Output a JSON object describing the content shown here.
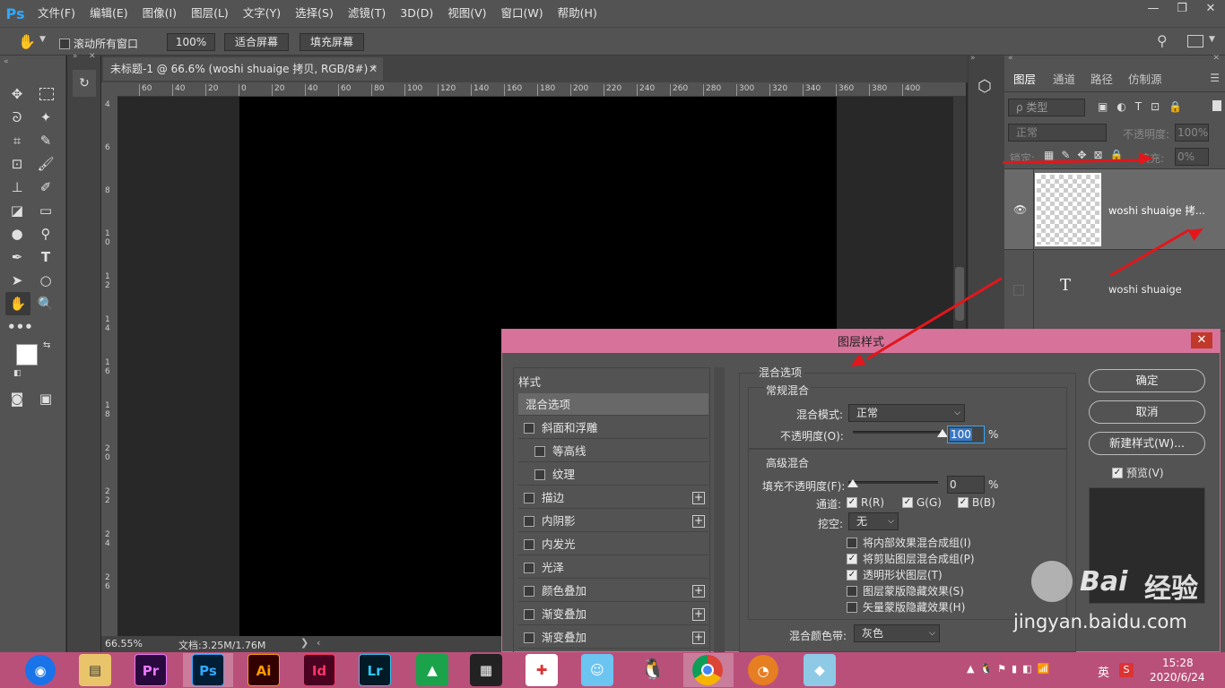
{
  "app": {
    "logo": "Ps"
  },
  "menu": [
    "文件(F)",
    "编辑(E)",
    "图像(I)",
    "图层(L)",
    "文字(Y)",
    "选择(S)",
    "滤镜(T)",
    "3D(D)",
    "视图(V)",
    "窗口(W)",
    "帮助(H)"
  ],
  "window_controls": {
    "minimize": "—",
    "restore": "❐",
    "close": "✕"
  },
  "options_bar": {
    "scroll_all": "滚动所有窗口",
    "zoom_value": "100%",
    "fit_screen": "适合屏幕",
    "fill_screen": "填充屏幕"
  },
  "document": {
    "tab_title": "未标题-1 @ 66.6% (woshi shuaige 拷贝, RGB/8#) *",
    "ruler_top": [
      "60",
      "40",
      "20",
      "0",
      "20",
      "40",
      "60",
      "80",
      "100",
      "120",
      "140",
      "160",
      "180",
      "200",
      "220",
      "240",
      "260",
      "280",
      "300",
      "320",
      "340",
      "360",
      "380",
      "400"
    ],
    "ruler_left": [
      "4",
      "6",
      "8",
      "1 0",
      "1 2",
      "1 4",
      "1 6",
      "1 8",
      "2 0",
      "2 2",
      "2 4",
      "2 6"
    ],
    "zoom_status": "66.55%",
    "doc_size": "文档:3.25M/1.76M"
  },
  "layers_panel": {
    "tabs": [
      "图层",
      "通道",
      "路径",
      "仿制源"
    ],
    "filter_label": "ρ 类型",
    "blend_mode": "正常",
    "opacity_label": "不透明度:",
    "opacity_value": "100%",
    "lock_label": "锁定:",
    "fill_label": "填充:",
    "fill_value": "0%",
    "layers": [
      {
        "name": "woshi shuaige 拷...",
        "type": "pixel",
        "visible": true
      },
      {
        "name": "woshi shuaige",
        "type": "text",
        "visible": false
      }
    ]
  },
  "dialog": {
    "title": "图层样式",
    "styles_header": "样式",
    "styles": [
      {
        "label": "混合选项",
        "checkbox": false,
        "plus": false,
        "active": true,
        "indent": 0
      },
      {
        "label": "斜面和浮雕",
        "checkbox": true,
        "plus": false,
        "indent": 0
      },
      {
        "label": "等高线",
        "checkbox": true,
        "plus": false,
        "indent": 1
      },
      {
        "label": "纹理",
        "checkbox": true,
        "plus": false,
        "indent": 1
      },
      {
        "label": "描边",
        "checkbox": true,
        "plus": true,
        "indent": 0
      },
      {
        "label": "内阴影",
        "checkbox": true,
        "plus": true,
        "indent": 0
      },
      {
        "label": "内发光",
        "checkbox": true,
        "plus": false,
        "indent": 0
      },
      {
        "label": "光泽",
        "checkbox": true,
        "plus": false,
        "indent": 0
      },
      {
        "label": "颜色叠加",
        "checkbox": true,
        "plus": true,
        "indent": 0
      },
      {
        "label": "渐变叠加",
        "checkbox": true,
        "plus": true,
        "indent": 0
      },
      {
        "label": "渐变叠加",
        "checkbox": true,
        "plus": true,
        "indent": 0
      }
    ],
    "blend_options": "混合选项",
    "general_blending": "常规混合",
    "blend_mode_label": "混合模式:",
    "blend_mode_value": "正常",
    "opacity_label": "不透明度(O):",
    "opacity_value": "100",
    "opacity_level": 1.0,
    "percent": "%",
    "advanced_blending": "高级混合",
    "fill_opacity_label": "填充不透明度(F):",
    "fill_opacity_value": "0",
    "fill_level": 0.0,
    "channels_label": "通道:",
    "channel_r": "R(R)",
    "channel_g": "G(G)",
    "channel_b": "B(B)",
    "knockout_label": "挖空:",
    "knockout_value": "无",
    "options": [
      {
        "label": "将内部效果混合成组(I)",
        "checked": false
      },
      {
        "label": "将剪贴图层混合成组(P)",
        "checked": true
      },
      {
        "label": "透明形状图层(T)",
        "checked": true
      },
      {
        "label": "图层蒙版隐藏效果(S)",
        "checked": false
      },
      {
        "label": "矢量蒙版隐藏效果(H)",
        "checked": false
      }
    ],
    "blend_if_label": "混合颜色带:",
    "blend_if_value": "灰色",
    "ok": "确定",
    "cancel": "取消",
    "new_style": "新建样式(W)...",
    "preview": "预览(V)"
  },
  "taskbar": {
    "apps": [
      "Pr",
      "Ps",
      "Ai",
      "Id",
      "Lr"
    ],
    "time": "15:28",
    "date": "2020/6/24",
    "ime": "英"
  },
  "watermark": {
    "brand": "Bai",
    "brand2": "经验",
    "url": "jingyan.baidu.com"
  },
  "colors": {
    "accent_ps": "#31a8ff",
    "dialog_title": "#d7739a",
    "taskbar": "#b9507a",
    "arrow": "#e3161b"
  }
}
